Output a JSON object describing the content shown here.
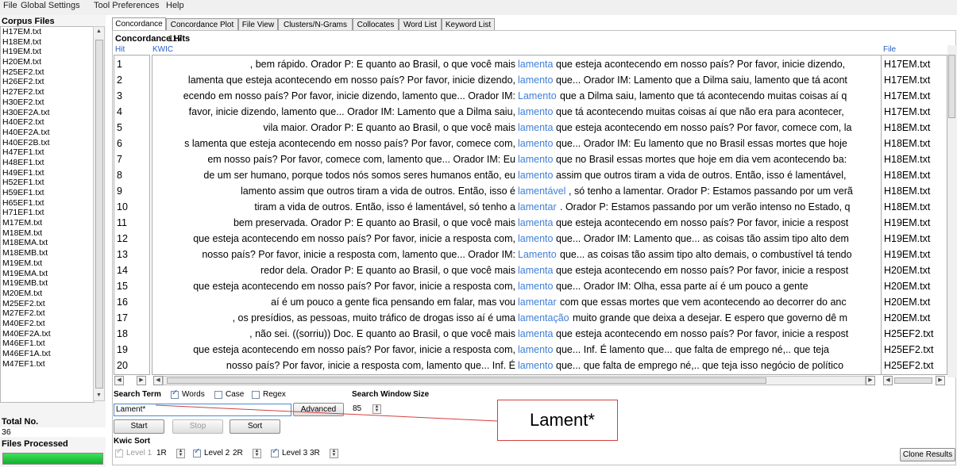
{
  "menu": [
    "File",
    "Global Settings",
    "Tool Preferences",
    "Help"
  ],
  "left_panel": {
    "title": "Corpus Files",
    "files": [
      "H17EM.txt",
      "H18EM.txt",
      "H19EM.txt",
      "H20EM.txt",
      "H25EF2.txt",
      "H26EF2.txt",
      "H27EF2.txt",
      "H30EF2.txt",
      "H30EF2A.txt",
      "H40EF2.txt",
      "H40EF2A.txt",
      "H40EF2B.txt",
      "H47EF1.txt",
      "H48EF1.txt",
      "H49EF1.txt",
      "H52EF1.txt",
      "H59EF1.txt",
      "H65EF1.txt",
      "H71EF1.txt",
      "M17EM.txt",
      "M18EM.txt",
      "M18EMA.txt",
      "M18EMB.txt",
      "M19EM.txt",
      "M19EMA.txt",
      "M19EMB.txt",
      "M20EM.txt",
      "M25EF2.txt",
      "M27EF2.txt",
      "M40EF2.txt",
      "M40EF2A.txt",
      "M46EF1.txt",
      "M46EF1A.txt",
      "M47EF1.txt"
    ],
    "total_label": "Total No.",
    "total_value": "36",
    "files_processed_label": "Files Processed",
    "progress": 1.0
  },
  "tabs": [
    "Concordance",
    "Concordance Plot",
    "File View",
    "Clusters/N-Grams",
    "Collocates",
    "Word List",
    "Keyword List"
  ],
  "active_tab": 0,
  "concordance": {
    "hits_label": "Concordance Hits",
    "hits_value": "117",
    "col_hit": "Hit",
    "col_kwic": "KWIC",
    "col_file": "File",
    "rows": [
      {
        "n": "1",
        "left": ", bem rápido. Orador P: E quanto ao Brasil, o que você mais",
        "kw": "lamenta",
        "right": "que esteja acontecendo em nosso país? Por favor, inicie dizendo,",
        "file": "H17EM.txt"
      },
      {
        "n": "2",
        "left": "lamenta que esteja acontecendo em nosso país? Por favor, inicie dizendo,",
        "kw": "lamento",
        "right": "que... Orador IM: Lamento que a Dilma saiu, lamento que tá acont",
        "file": "H17EM.txt"
      },
      {
        "n": "3",
        "left": "ecendo em nosso país? Por favor, inicie dizendo, lamento que... Orador IM:",
        "kw": "Lamento",
        "right": "que a Dilma saiu, lamento que tá acontecendo muitas coisas aí q",
        "file": "H17EM.txt"
      },
      {
        "n": "4",
        "left": "favor, inicie dizendo, lamento que... Orador IM: Lamento que a Dilma saiu,",
        "kw": "lamento",
        "right": "que tá acontecendo muitas coisas aí que não era para acontecer,",
        "file": "H17EM.txt"
      },
      {
        "n": "5",
        "left": "vila maior. Orador P: E quanto ao Brasil, o que você mais",
        "kw": "lamenta",
        "right": "que esteja acontecendo em nosso país? Por favor, comece com, la",
        "file": "H18EM.txt"
      },
      {
        "n": "6",
        "left": "s lamenta que esteja acontecendo em nosso país? Por favor, comece com,",
        "kw": "lamento",
        "right": "que... Orador IM: Eu lamento que no Brasil essas mortes que hoje",
        "file": "H18EM.txt"
      },
      {
        "n": "7",
        "left": "em nosso país? Por favor, comece com, lamento que... Orador IM: Eu",
        "kw": "lamento",
        "right": "que no Brasil essas mortes que hoje em dia vem acontecendo ba:",
        "file": "H18EM.txt"
      },
      {
        "n": "8",
        "left": "de um ser humano, porque todos nós somos seres humanos então, eu",
        "kw": "lamento",
        "right": "assim que outros tiram a vida de outros. Então, isso é lamentável,",
        "file": "H18EM.txt"
      },
      {
        "n": "9",
        "left": "lamento assim que outros tiram a vida de outros. Então, isso é",
        "kw": "lamentável",
        "right": ", só tenho a lamentar. Orador P: Estamos passando por um verã",
        "file": "H18EM.txt"
      },
      {
        "n": "10",
        "left": "tiram a vida de outros. Então, isso é lamentável, só tenho a",
        "kw": "lamentar",
        "right": ". Orador P: Estamos passando por um verão intenso no Estado, q",
        "file": "H18EM.txt"
      },
      {
        "n": "11",
        "left": "bem preservada. Orador P: E quanto ao Brasil, o que você mais",
        "kw": "lamenta",
        "right": "que esteja acontecendo em nosso país? Por favor, inicie a respost",
        "file": "H19EM.txt"
      },
      {
        "n": "12",
        "left": "que esteja acontecendo em nosso país? Por favor, inicie a resposta com,",
        "kw": "lamento",
        "right": "que... Orador IM: Lamento que... as coisas tão assim tipo alto dem",
        "file": "H19EM.txt"
      },
      {
        "n": "13",
        "left": "nosso país? Por favor, inicie a resposta com, lamento que... Orador IM:",
        "kw": "Lamento",
        "right": "que... as coisas tão assim tipo alto demais, o combustível tá tendo",
        "file": "H19EM.txt"
      },
      {
        "n": "14",
        "left": "redor dela. Orador P: E quanto ao Brasil, o que você mais",
        "kw": "lamenta",
        "right": "que esteja acontecendo em nosso país? Por favor, inicie a respost",
        "file": "H20EM.txt"
      },
      {
        "n": "15",
        "left": "que esteja acontecendo em nosso país? Por favor, inicie a resposta com,",
        "kw": "lamento",
        "right": "que... Orador IM: Olha, essa parte aí é um pouco a gente",
        "file": "H20EM.txt"
      },
      {
        "n": "16",
        "left": "aí é um pouco a gente fica pensando em falar, mas vou",
        "kw": "lamentar",
        "right": "com que essas mortes que vem acontecendo ao decorrer do anc",
        "file": "H20EM.txt"
      },
      {
        "n": "17",
        "left": ", os presídios, as pessoas, muito tráfico de drogas isso aí é uma",
        "kw": "lamentação",
        "right": "muito grande que deixa a desejar. E espero que governo dê m",
        "file": "H20EM.txt"
      },
      {
        "n": "18",
        "left": ", não sei. ((sorriu)) Doc. E quanto ao Brasil, o que você mais",
        "kw": "lamenta",
        "right": "que esteja acontecendo em nosso país? Por favor, inicie a respost",
        "file": "H25EF2.txt"
      },
      {
        "n": "19",
        "left": "que esteja acontecendo em nosso país? Por favor, inicie a resposta com,",
        "kw": "lamento",
        "right": "que... Inf. É lamento que... que falta de emprego né,.. que teja",
        "file": "H25EF2.txt"
      },
      {
        "n": "20",
        "left": "nosso país? Por favor, inicie a resposta com, lamento que... Inf. É",
        "kw": "lamento",
        "right": "que... que falta de emprego né,.. que teja isso negócio de político",
        "file": "H25EF2.txt"
      }
    ]
  },
  "search": {
    "term_label": "Search Term",
    "words_label": "Words",
    "case_label": "Case",
    "regex_label": "Regex",
    "words_checked": true,
    "case_checked": false,
    "regex_checked": false,
    "query": "Lament*",
    "advanced_label": "Advanced",
    "window_label": "Search Window Size",
    "window_value": "85",
    "start_label": "Start",
    "stop_label": "Stop",
    "sort_label": "Sort"
  },
  "kwic_sort": {
    "label": "Kwic Sort",
    "level1_label": "Level 1",
    "level1_value": "1R",
    "level2_label": "Level 2",
    "level2_value": "2R",
    "level3_label": "Level 3",
    "level3_value": "3R"
  },
  "clone_label": "Clone Results",
  "callout_text": "Lament*",
  "colors": {
    "keyword": "#3f7fd6",
    "header_blue": "#2a5fc4",
    "callout_border": "#d24040",
    "progress": "#1fc43a"
  }
}
